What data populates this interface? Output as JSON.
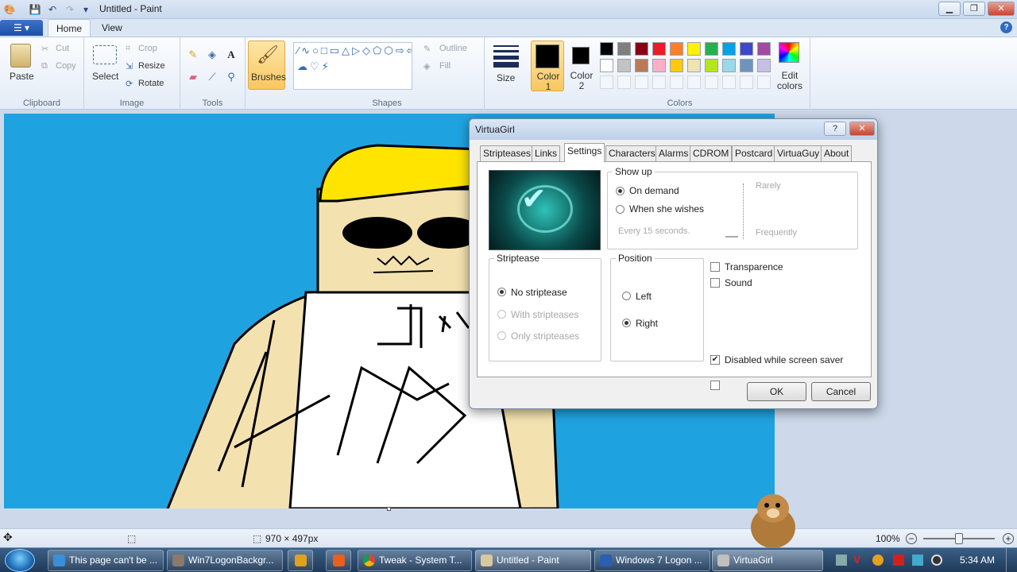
{
  "window": {
    "title": "Untitled - Paint"
  },
  "ribbon": {
    "tabs": [
      "Home",
      "View"
    ],
    "clipboard": {
      "label": "Clipboard",
      "paste": "Paste",
      "cut": "Cut",
      "copy": "Copy"
    },
    "image": {
      "label": "Image",
      "select": "Select",
      "crop": "Crop",
      "resize": "Resize",
      "rotate": "Rotate"
    },
    "tools": {
      "label": "Tools"
    },
    "brushes": {
      "label": "Brushes"
    },
    "shapes": {
      "label": "Shapes",
      "outline": "Outline",
      "fill": "Fill"
    },
    "size": {
      "label": "Size"
    },
    "color1": {
      "label": "Color 1"
    },
    "color2": {
      "label": "Color 2"
    },
    "colors": {
      "label": "Colors"
    },
    "edit_colors": {
      "label": "Edit colors"
    },
    "palette_row1": [
      "#000000",
      "#7f7f7f",
      "#880015",
      "#ed1c24",
      "#ff7f27",
      "#fff200",
      "#22b14c",
      "#00a2e8",
      "#3f48cc",
      "#a349a4"
    ],
    "palette_row2": [
      "#ffffff",
      "#c3c3c3",
      "#b97a57",
      "#ffaec9",
      "#ffc90e",
      "#efe4b0",
      "#b5e61d",
      "#99d9ea",
      "#7092be",
      "#c8bfe7"
    ]
  },
  "colors": {
    "canvas_bg": "#1fa3e0",
    "accent": "#3e73c7"
  },
  "status": {
    "dimensions": "970 × 497px",
    "zoom": "100%",
    "zoom_level": 0.5
  },
  "dialog": {
    "title": "VirtuaGirl",
    "tabs": [
      "Stripteases!",
      "Links",
      "Settings",
      "Characters",
      "Alarms",
      "CDROM",
      "Postcard",
      "VirtuaGuy",
      "About"
    ],
    "active_tab": "Settings",
    "show_up": {
      "legend": "Show up",
      "on_demand": "On demand",
      "when_she_wishes": "When she wishes",
      "interval": "Every 15 seconds.",
      "rarely": "Rarely",
      "frequently": "Frequently"
    },
    "striptease": {
      "legend": "Striptease",
      "none": "No striptease",
      "with": "With stripteases",
      "only": "Only stripteases"
    },
    "position": {
      "legend": "Position",
      "left": "Left",
      "right": "Right"
    },
    "transparence": "Transparence",
    "sound": "Sound",
    "disabled_screensaver": "Disabled while screen saver",
    "ok": "OK",
    "cancel": "Cancel"
  },
  "taskbar": {
    "items": [
      "This page can't be ...",
      "Win7LogonBackgr...",
      "Tweak - System T...",
      "Untitled - Paint",
      "Windows 7 Logon ...",
      "VirtuaGirl"
    ],
    "time": "5:34 AM"
  }
}
